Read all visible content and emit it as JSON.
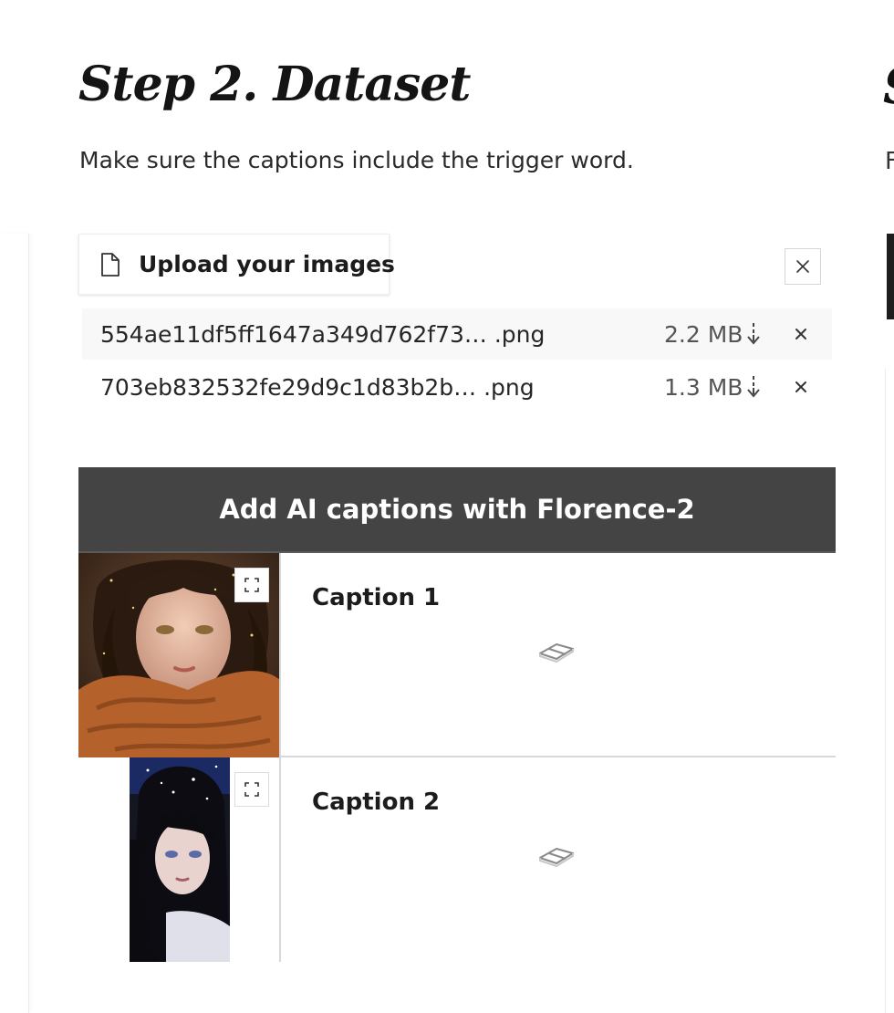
{
  "page": {
    "title": "Step 2. Dataset",
    "description": "Make sure the captions include the trigger word."
  },
  "upload": {
    "button_label": "Upload your images",
    "clear_icon": "close-icon",
    "files": [
      {
        "name": "554ae11df5ff1647a349d762f73… .png",
        "size": "2.2 MB"
      },
      {
        "name": "703eb832532fe29d9c1d83b2b…  .png",
        "size": "1.3 MB"
      }
    ]
  },
  "captions": {
    "button_label": "Add AI captions with Florence-2",
    "items": [
      {
        "label": "Caption 1"
      },
      {
        "label": "Caption 2"
      }
    ]
  },
  "icons": {
    "file": "file-icon",
    "download": "download-arrow-icon",
    "remove": "close-icon",
    "expand": "fullscreen-icon",
    "resize": "resize-handle-icon"
  },
  "colors": {
    "caption_button_bg": "#444444",
    "file_row_alt_bg": "#f8f8f8"
  }
}
